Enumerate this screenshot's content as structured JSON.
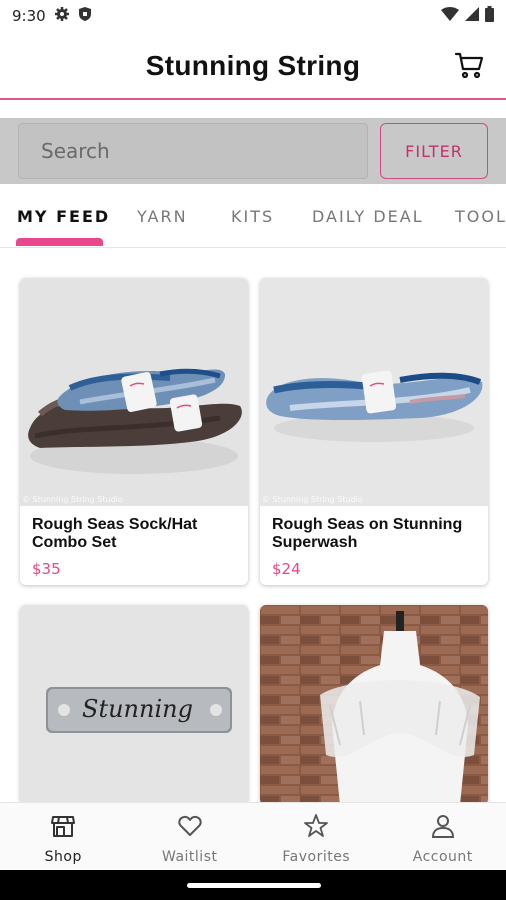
{
  "status_bar": {
    "time": "9:30",
    "icons": [
      "settings-gear-icon",
      "shield-icon",
      "wifi-icon",
      "signal-icon",
      "battery-icon"
    ]
  },
  "app": {
    "title": "Stunning String",
    "cart_icon": "cart-icon",
    "brand_color": "#e8478b"
  },
  "search": {
    "placeholder": "Search",
    "value": "",
    "filter_label": "FILTER"
  },
  "tabs": [
    {
      "label": "MY FEED",
      "active": true
    },
    {
      "label": "YARN",
      "active": false
    },
    {
      "label": "KITS",
      "active": false
    },
    {
      "label": "DAILY DEAL",
      "active": false
    },
    {
      "label": "TOOLS",
      "active": false
    }
  ],
  "products": [
    {
      "name": "Rough Seas Sock/Hat Combo Set",
      "price": "$35",
      "watermark": "© Stunning String Studio"
    },
    {
      "name": "Rough Seas on Stunning Superwash",
      "price": "$24",
      "watermark": "© Stunning String Studio"
    },
    {
      "name": "",
      "price": "",
      "image_text": "Stunning"
    },
    {
      "name": "",
      "price": ""
    }
  ],
  "bottom_nav": [
    {
      "label": "Shop",
      "icon": "shop-icon",
      "active": true
    },
    {
      "label": "Waitlist",
      "icon": "heart-icon",
      "active": false
    },
    {
      "label": "Favorites",
      "icon": "star-icon",
      "active": false
    },
    {
      "label": "Account",
      "icon": "person-icon",
      "active": false
    }
  ]
}
